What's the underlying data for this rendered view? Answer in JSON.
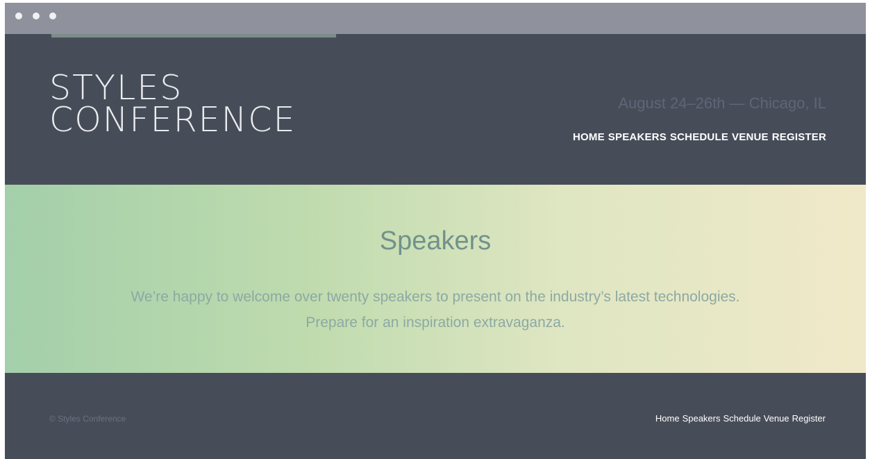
{
  "logo": {
    "line1": "Styles",
    "line2": "Conference"
  },
  "header": {
    "tagline": "August 24–26th — Chicago, IL",
    "nav": [
      "Home",
      "Speakers",
      "Schedule",
      "Venue",
      "Register"
    ]
  },
  "hero": {
    "title": "Speakers",
    "text_line1": "We’re happy to welcome over twenty speakers to present on the industry’s latest technologies.",
    "text_line2": "Prepare for an inspiration extravaganza."
  },
  "footer": {
    "copyright": "© Styles Conference",
    "nav": [
      "Home",
      "Speakers",
      "Schedule",
      "Venue",
      "Register"
    ]
  },
  "colors": {
    "header_bg": "#474d58",
    "hero_gradient_start": "#a3cfaa",
    "hero_gradient_end": "#f0e9c9",
    "hero_title": "#71928c"
  }
}
